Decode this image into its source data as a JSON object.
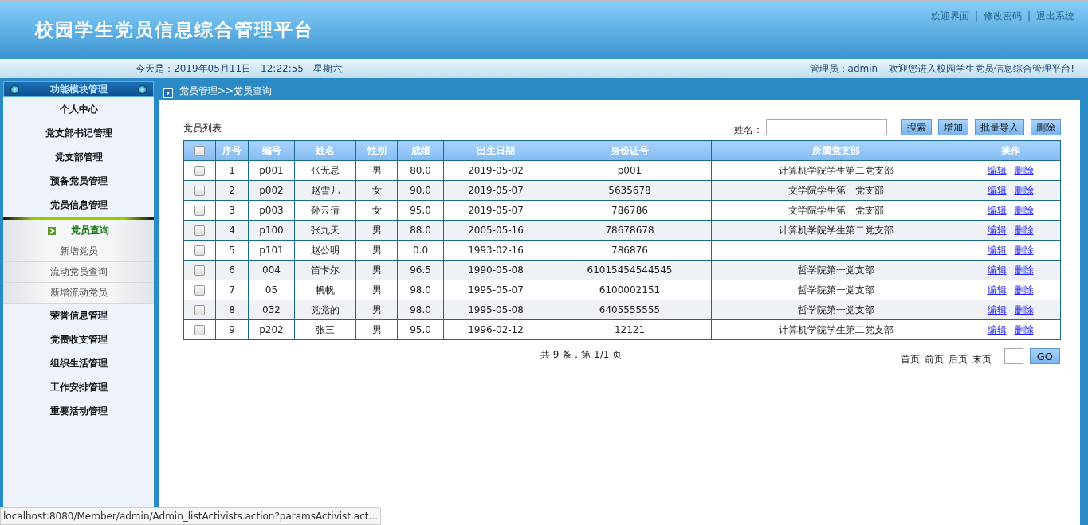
{
  "header": {
    "title": "校园学生党员信息综合管理平台",
    "links": [
      "欢迎界面",
      "修改密码",
      "退出系统"
    ],
    "separator": "|"
  },
  "info_bar": {
    "date": "今天是：2019年05月11日　12:22:55　星期六",
    "admin": "管理员：admin",
    "welcome": "欢迎您进入校园学生党员信息综合管理平台!"
  },
  "sidebar": {
    "title": "功能模块管理",
    "items": [
      {
        "label": "个人中心"
      },
      {
        "label": "党支部书记管理"
      },
      {
        "label": "党支部管理"
      },
      {
        "label": "预备党员管理"
      },
      {
        "label": "党员信息管理",
        "expanded": true,
        "children": [
          {
            "label": "党员查询",
            "selected": true
          },
          {
            "label": "新增党员",
            "selected": false
          },
          {
            "label": "流动党员查询",
            "selected": false
          },
          {
            "label": "新增流动党员",
            "selected": false
          }
        ]
      },
      {
        "label": "荣誉信息管理"
      },
      {
        "label": "党费收支管理"
      },
      {
        "label": "组织生活管理"
      },
      {
        "label": "工作安排管理"
      },
      {
        "label": "重要活动管理"
      }
    ]
  },
  "breadcrumb": "党员管理>>党员查询",
  "list_title": "党员列表",
  "search": {
    "label": "姓名：",
    "buttons": [
      "搜索",
      "增加",
      "批量导入",
      "删除"
    ]
  },
  "table": {
    "header_checked": false,
    "columns": [
      "序号",
      "编号",
      "姓名",
      "性别",
      "成绩",
      "出生日期",
      "身份证号",
      "所属党支部",
      "操作"
    ],
    "rows": [
      {
        "checked": false,
        "cells": [
          "1",
          "p001",
          "张无忌",
          "男",
          "80.0",
          "2019-05-02",
          "p001",
          "计算机学院学生第二党支部"
        ],
        "actions": [
          "编辑",
          "删除"
        ]
      },
      {
        "checked": false,
        "cells": [
          "2",
          "p002",
          "赵雪儿",
          "女",
          "90.0",
          "2019-05-07",
          "5635678",
          "文学院学生第一党支部"
        ],
        "actions": [
          "编辑",
          "删除"
        ]
      },
      {
        "checked": false,
        "cells": [
          "3",
          "p003",
          "孙云倩",
          "女",
          "95.0",
          "2019-05-07",
          "786786",
          "文学院学生第一党支部"
        ],
        "actions": [
          "编辑",
          "删除"
        ]
      },
      {
        "checked": false,
        "cells": [
          "4",
          "p100",
          "张九天",
          "男",
          "88.0",
          "2005-05-16",
          "78678678",
          "计算机学院学生第二党支部"
        ],
        "actions": [
          "编辑",
          "删除"
        ]
      },
      {
        "checked": false,
        "cells": [
          "5",
          "p101",
          "赵公明",
          "男",
          "0.0",
          "1993-02-16",
          "786876",
          ""
        ],
        "actions": [
          "编辑",
          "删除"
        ]
      },
      {
        "checked": false,
        "cells": [
          "6",
          "004",
          "笛卡尔",
          "男",
          "96.5",
          "1990-05-08",
          "61015454544545",
          "哲学院第一党支部"
        ],
        "actions": [
          "编辑",
          "删除"
        ]
      },
      {
        "checked": false,
        "cells": [
          "7",
          "05",
          "帆帆",
          "男",
          "98.0",
          "1995-05-07",
          "6100002151",
          "哲学院第一党支部"
        ],
        "actions": [
          "编辑",
          "删除"
        ]
      },
      {
        "checked": false,
        "cells": [
          "8",
          "032",
          "党党的",
          "男",
          "98.0",
          "1995-05-08",
          "6405555555",
          "哲学院第一党支部"
        ],
        "actions": [
          "编辑",
          "删除"
        ]
      },
      {
        "checked": false,
        "cells": [
          "9",
          "p202",
          "张三",
          "男",
          "95.0",
          "1996-02-12",
          "12121",
          "计算机学院学生第二党支部"
        ],
        "actions": [
          "编辑",
          "删除"
        ]
      }
    ]
  },
  "pagination": {
    "summary": "共 9 条，第 1/1 页",
    "links": [
      "首页",
      "前页",
      "后页",
      "末页"
    ],
    "go": "GO"
  },
  "status_url": "localhost:8080/Member/admin/Admin_listActivists.action?paramsActivist.act..."
}
